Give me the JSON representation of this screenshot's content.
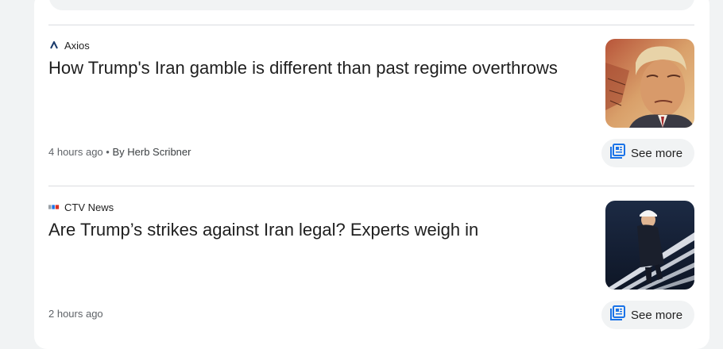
{
  "articles": [
    {
      "source": "Axios",
      "headline": "How Trump's Iran gamble is different than past regime overthrows",
      "time": "4 hours ago",
      "separator": "•",
      "byline": "By Herb Scribner",
      "see_more": "See more",
      "logo_icon": "axios-logo-icon",
      "image": "trump-portrait-on-map"
    },
    {
      "source": "CTV News",
      "headline": "Are Trump’s strikes against Iran legal? Experts weigh in",
      "time": "2 hours ago",
      "see_more": "See more",
      "logo_icon": "ctv-news-logo-icon",
      "image": "trump-descending-stairs"
    }
  ],
  "colors": {
    "accent": "#1a73e8",
    "axios_logo": "#1a3a6b",
    "see_more_bg": "#f1f3f4"
  }
}
